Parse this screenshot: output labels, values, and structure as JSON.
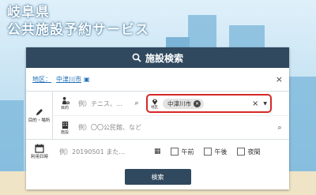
{
  "hero": {
    "line1": "岐阜県",
    "line2": "公共施設予約サービス"
  },
  "panel": {
    "title": "施設検索"
  },
  "filter": {
    "label": "地区：",
    "value": "中津川市",
    "clear": "×"
  },
  "block1": {
    "side_label": "目的・場所",
    "purpose": {
      "icon_label": "目的",
      "placeholder": "例）テニス、…"
    },
    "area": {
      "icon_label": "地区",
      "chip": "中津川市",
      "clear": "×",
      "dropdown": "▼"
    },
    "facility": {
      "icon_label": "施設",
      "placeholder": "例）〇〇公民館、など"
    }
  },
  "date": {
    "side_label": "利用日時",
    "placeholder": "例）20190501 また…",
    "options": [
      "午前",
      "午後",
      "夜間"
    ]
  },
  "search_button": "検索"
}
